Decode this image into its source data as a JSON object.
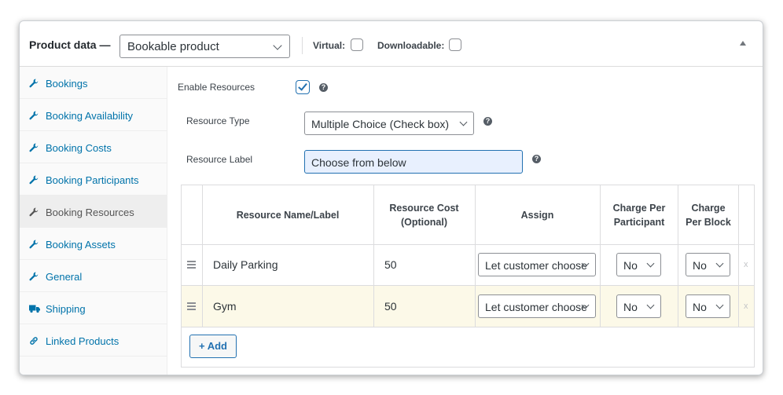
{
  "header": {
    "title": "Product data —",
    "product_type": "Bookable product",
    "virtual_label": "Virtual:",
    "downloadable_label": "Downloadable:"
  },
  "sidebar": {
    "items": [
      {
        "label": "Bookings",
        "icon": "wrench-icon"
      },
      {
        "label": "Booking Availability",
        "icon": "wrench-icon"
      },
      {
        "label": "Booking Costs",
        "icon": "wrench-icon"
      },
      {
        "label": "Booking Participants",
        "icon": "wrench-icon"
      },
      {
        "label": "Booking Resources",
        "icon": "wrench-icon",
        "active": true
      },
      {
        "label": "Booking Assets",
        "icon": "wrench-icon"
      },
      {
        "label": "General",
        "icon": "wrench-icon"
      },
      {
        "label": "Shipping",
        "icon": "truck-icon"
      },
      {
        "label": "Linked Products",
        "icon": "link-icon"
      }
    ]
  },
  "resources": {
    "enable_label": "Enable Resources",
    "enable_checked": true,
    "type_label": "Resource Type",
    "type_value": "Multiple Choice (Check box)",
    "label_label": "Resource Label",
    "label_value": "Choose from below",
    "help_glyph": "?"
  },
  "table": {
    "headers": {
      "name": "Resource Name/Label",
      "cost": "Resource Cost (Optional)",
      "assign": "Assign",
      "per_participant": "Charge Per Participant",
      "per_block": "Charge Per Block"
    },
    "rows": [
      {
        "name": "Daily Parking",
        "cost": "50",
        "assign": "Let customer choose",
        "per_participant": "No",
        "per_block": "No",
        "remove": "x"
      },
      {
        "name": "Gym",
        "cost": "50",
        "assign": "Let customer choose",
        "per_participant": "No",
        "per_block": "No",
        "remove": "x"
      }
    ],
    "add_label": "+ Add"
  },
  "colors": {
    "link": "#0073aa",
    "accent": "#2271b1",
    "highlight_row": "#fcf9e8"
  }
}
